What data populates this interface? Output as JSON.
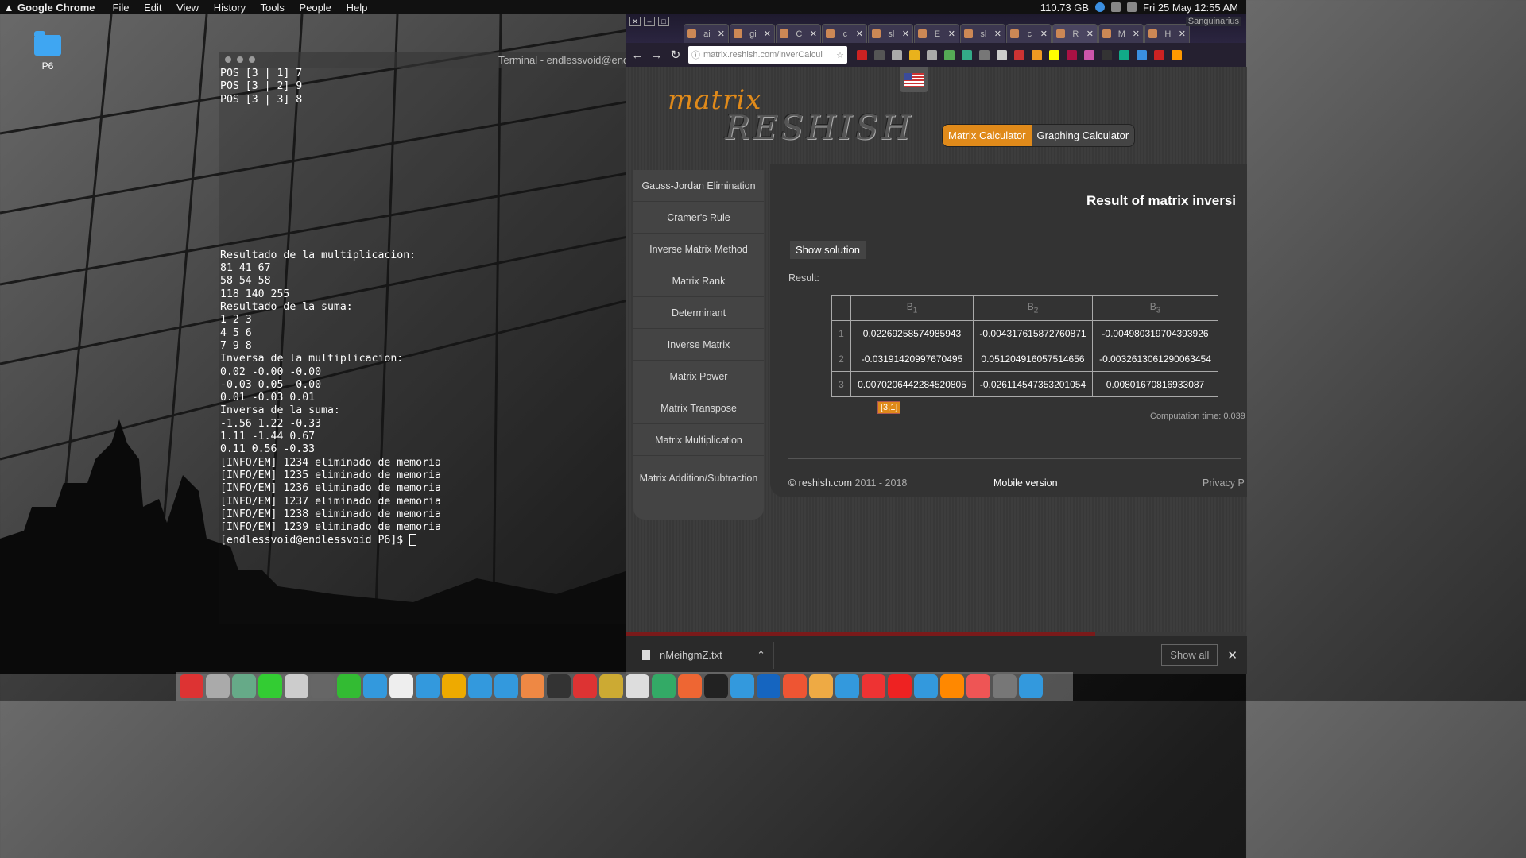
{
  "topbar": {
    "app_name": "Google Chrome",
    "menu": [
      "File",
      "Edit",
      "View",
      "History",
      "Tools",
      "People",
      "Help"
    ],
    "disk": "110.73 GB",
    "datetime": "Fri 25 May  12:55 AM"
  },
  "desktop": {
    "folder_label": "P6"
  },
  "terminal": {
    "title": "Terminal - endlessvoid@end",
    "lines_top": [
      "POS [3 | 1] 7",
      "POS [3 | 2] 9",
      "POS [3 | 3] 8"
    ],
    "lines_bottom": [
      "Resultado de la multiplicacion:",
      "81 41 67",
      "58 54 58",
      "118 140 255",
      "Resultado de la suma:",
      "1 2 3",
      "4 5 6",
      "7 9 8",
      "Inversa de la multiplicacion:",
      "0.02 -0.00 -0.00",
      "-0.03 0.05 -0.00",
      "0.01 -0.03 0.01",
      "Inversa de la suma:",
      "-1.56 1.22 -0.33",
      "1.11 -1.44 0.67",
      "0.11 0.56 -0.33",
      "[INFO/EM] 1234 eliminado de memoria",
      "[INFO/EM] 1235 eliminado de memoria",
      "[INFO/EM] 1236 eliminado de memoria",
      "[INFO/EM] 1237 eliminado de memoria",
      "[INFO/EM] 1238 eliminado de memoria",
      "[INFO/EM] 1239 eliminado de memoria"
    ],
    "prompt": "[endlessvoid@endlessvoid P6]$ "
  },
  "chrome": {
    "profile": "Sanguinarius",
    "tabs": [
      "ai",
      "gi",
      "C",
      "c",
      "sl",
      "E",
      "sl",
      "c",
      "R",
      "M",
      "H"
    ],
    "url": "matrix.reshish.com/inverCalcul",
    "ext_colors": [
      "#c22",
      "#555",
      "#aaa",
      "#e9b21c",
      "#aaa",
      "#5a5",
      "#3a8",
      "#777",
      "#ccc",
      "#c33",
      "#e92",
      "#ff0",
      "#a14",
      "#c5a",
      "#333",
      "#1a8",
      "#3a8fe0",
      "#c22",
      "#f90"
    ]
  },
  "page": {
    "logo_top": "matrix",
    "logo_bottom": "RESHISH",
    "calc_tabs": [
      "Matrix Calculator",
      "Graphing Calculator"
    ],
    "sidebar": [
      "Gauss-Jordan Elimination",
      "Cramer's Rule",
      "Inverse Matrix Method",
      "Matrix Rank",
      "Determinant",
      "Inverse Matrix",
      "Matrix Power",
      "Matrix Transpose",
      "Matrix Multiplication",
      "Matrix Addition/Subtraction"
    ],
    "result_title": "Result of matrix inversi",
    "show_solution": "Show solution",
    "result_label": "Result:",
    "table_headers": [
      "B",
      "B",
      "B"
    ],
    "table_subs": [
      "1",
      "2",
      "3"
    ],
    "rows": [
      {
        "idx": "1",
        "cells": [
          "0.02269258574985943",
          "-0.004317615872760871",
          "-0.004980319704393926"
        ]
      },
      {
        "idx": "2",
        "cells": [
          "-0.03191420997670495",
          "0.051204916057514656",
          "-0.0032613061290063454"
        ]
      },
      {
        "idx": "3",
        "cells": [
          "0.0070206442284520805",
          "-0.026114547353201054",
          "0.00801670816933087"
        ]
      }
    ],
    "cell_badge": "[3,1]",
    "computation_time": "Computation time: 0.039",
    "footer_copy": "© reshish.com",
    "footer_years": " 2011 - 2018",
    "mobile": "Mobile version",
    "privacy": "Privacy P"
  },
  "download_bar": {
    "file": "nMeihgmZ.txt",
    "show_all": "Show all"
  },
  "dock_colors": [
    "#d33",
    "#aaa",
    "#6a8",
    "#3c3",
    "#ccc",
    "#666",
    "#3b3",
    "#39d",
    "#eee",
    "#39d",
    "#ea0",
    "#39d",
    "#39d",
    "#e84",
    "#333",
    "#d33",
    "#ca3",
    "#ddd",
    "#3a6",
    "#e63",
    "#222",
    "#39d",
    "#1565c0",
    "#e53",
    "#ea4",
    "#39d",
    "#e33",
    "#e22",
    "#39d",
    "#f80",
    "#e55",
    "#777",
    "#39d"
  ]
}
